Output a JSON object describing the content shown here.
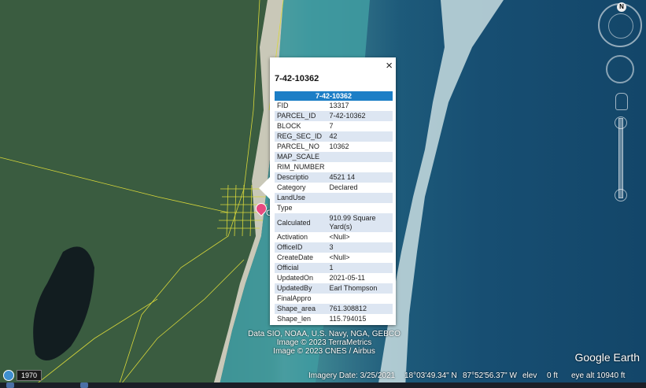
{
  "popup": {
    "title": "7-42-10362",
    "close_label": "×",
    "header": "7-42-10362",
    "rows": [
      {
        "key": "FID",
        "value": "13317"
      },
      {
        "key": "PARCEL_ID",
        "value": "7-42-10362"
      },
      {
        "key": "BLOCK",
        "value": "7"
      },
      {
        "key": "REG_SEC_ID",
        "value": "42"
      },
      {
        "key": "PARCEL_NO",
        "value": "10362"
      },
      {
        "key": "MAP_SCALE",
        "value": ""
      },
      {
        "key": "RIM_NUMBER",
        "value": ""
      },
      {
        "key": "Descriptio",
        "value": "4521 14"
      },
      {
        "key": "Category",
        "value": "Declared"
      },
      {
        "key": "LandUse",
        "value": ""
      },
      {
        "key": "Type",
        "value": ""
      },
      {
        "key": "Calculated",
        "value": "910.99 Square Yard(s)"
      },
      {
        "key": "Activation",
        "value": "<Null>"
      },
      {
        "key": "OfficeID",
        "value": "3"
      },
      {
        "key": "CreateDate",
        "value": "<Null>"
      },
      {
        "key": "Official",
        "value": "1"
      },
      {
        "key": "UpdatedOn",
        "value": "2021-05-11"
      },
      {
        "key": "UpdatedBy",
        "value": "Earl Thompson"
      },
      {
        "key": "FinalAppro",
        "value": ""
      },
      {
        "key": "Shape_area",
        "value": "761.308812"
      },
      {
        "key": "Shape_len",
        "value": "115.794015"
      }
    ]
  },
  "credits": {
    "line1": "Data SIO, NOAA, U.S. Navy, NGA, GEBCO",
    "line2": "Image © 2023 TerraMetrics",
    "line3": "Image © 2023 CNES / Airbus"
  },
  "logo": "Google Earth",
  "pin_label": "C",
  "status": {
    "year": "1970",
    "imagery_date": "Imagery Date: 3/25/2021",
    "lat": "18°03'49.34\" N",
    "lon": "87°52'56.37\" W",
    "elev_label": "elev",
    "elev_value": "0 ft",
    "eye_alt": "eye alt  10940 ft"
  },
  "compass": {
    "north": "N"
  },
  "icons": [
    "globe-icon",
    "compass-icon",
    "look-joystick-icon",
    "pegman-icon",
    "zoom-in-icon",
    "zoom-out-icon",
    "close-icon",
    "placemark-icon"
  ]
}
